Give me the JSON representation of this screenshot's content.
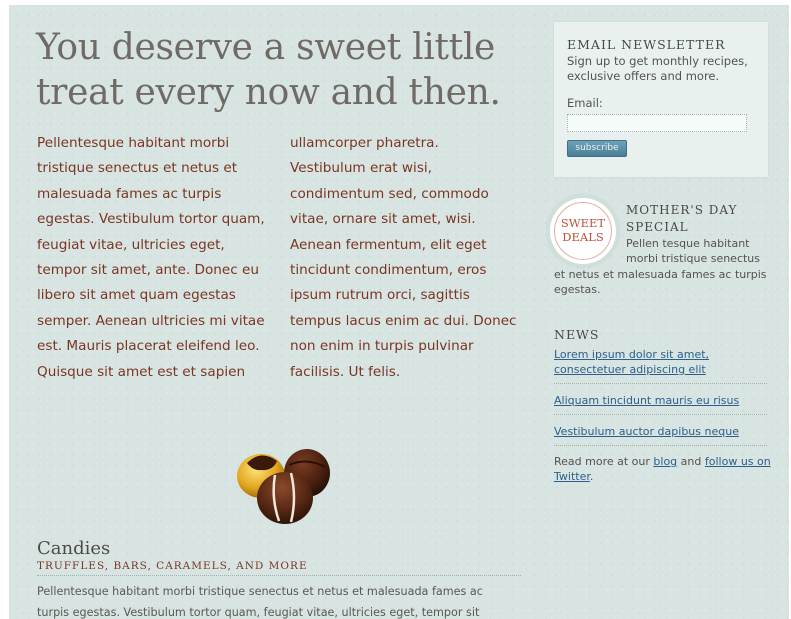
{
  "headline": "You deserve a sweet little treat every now and then.",
  "columns": {
    "left": "Pellentesque habitant morbi tristique senectus et netus et malesuada fames ac turpis egestas. Vestibulum tortor quam, feugiat vitae, ultricies eget, tempor sit amet, ante. Donec eu libero sit amet quam egestas semper. Aenean ultricies mi vitae est. Mauris placerat eleifend leo. Quisque sit amet est et sapien",
    "right": "ullamcorper pharetra. Vestibulum erat wisi, condimentum sed, commodo vitae, ornare sit amet, wisi. Aenean fermentum, elit eget tincidunt condimentum, eros ipsum rutrum orci, sagittis tempus lacus enim ac dui. Donec non enim in turpis pulvinar facilisis. Ut felis."
  },
  "candies": {
    "title": "Candies",
    "subtitle": "TRUFFLES, BARS, CARAMELS, AND MORE",
    "text": "Pellentesque habitant morbi tristique senectus et netus et malesuada fames ac turpis egestas. Vestibulum tortor quam, feugiat vitae, ultricies eget, tempor sit"
  },
  "newsletter": {
    "title": "EMAIL NEWSLETTER",
    "description": "Sign up to get monthly recipes, exclusive offers and more.",
    "email_label": "Email:",
    "email_value": "",
    "button_label": "subscribe"
  },
  "mothers_day": {
    "badge_line1": "SWEET",
    "badge_line2": "DEALS",
    "title": "MOTHER'S DAY SPECIAL",
    "text_part1": "Pellen tesque habitant morbi tristique senectus",
    "text_part2": "et netus et malesuada fames ac turpis egestas."
  },
  "news": {
    "title": "NEWS",
    "links": [
      "Lorem ipsum dolor sit amet, consectetuer adipiscing elit",
      "Aliquam tincidunt mauris eu risus",
      "Vestibulum auctor dapibus neque"
    ],
    "more_prefix": "Read more at our ",
    "blog_link": "blog",
    "and_text": " and ",
    "twitter_link": "follow us on Twitter",
    "suffix": "."
  }
}
